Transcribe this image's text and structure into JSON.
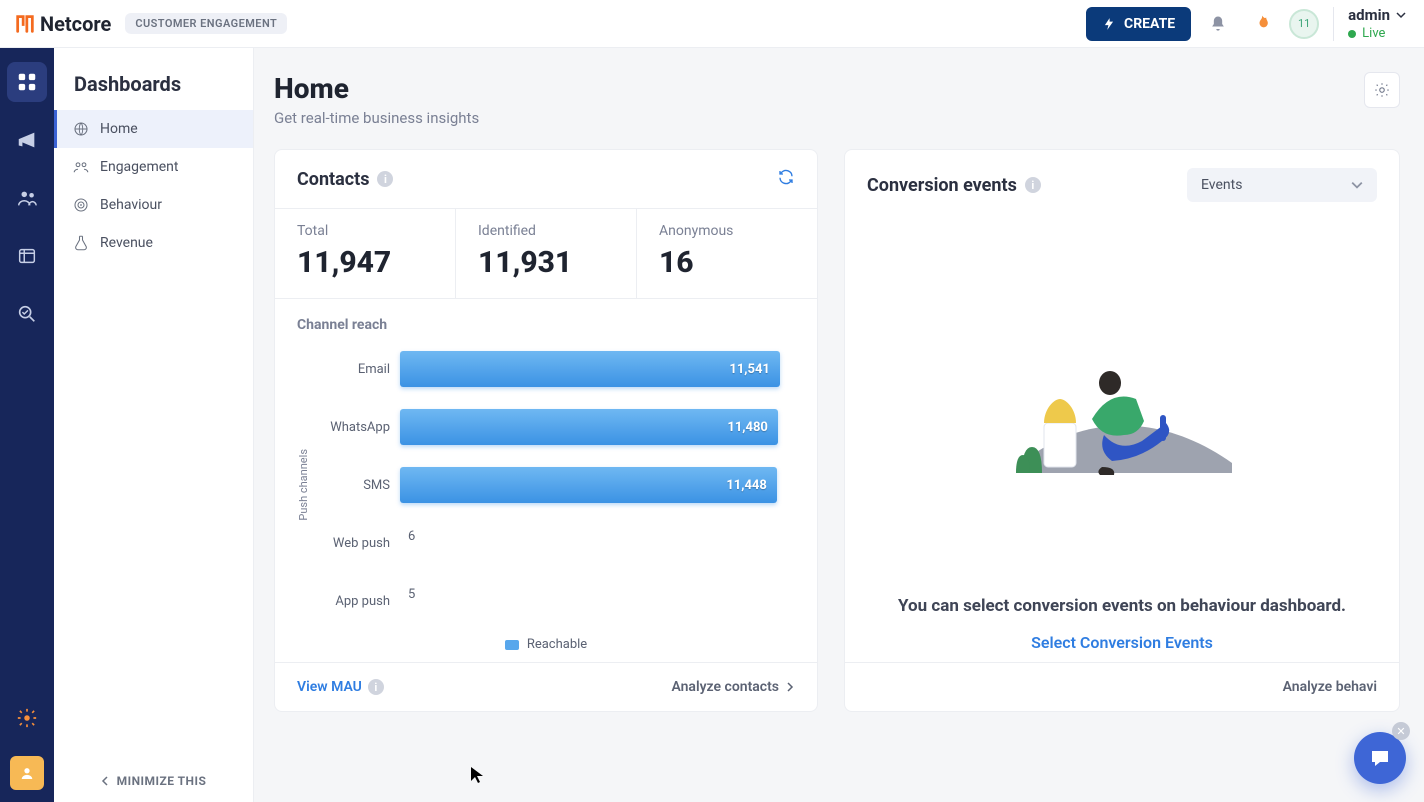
{
  "brand": {
    "name": "Netcore",
    "product_chip": "CUSTOMER ENGAGEMENT"
  },
  "topbar": {
    "create_label": "CREATE",
    "avatar_badge": "11",
    "user_name": "admin",
    "status_label": "Live"
  },
  "rail": {
    "items": [
      {
        "name": "dashboards",
        "active": true
      },
      {
        "name": "campaigns"
      },
      {
        "name": "audience"
      },
      {
        "name": "content"
      },
      {
        "name": "analytics"
      }
    ]
  },
  "sidebar": {
    "title": "Dashboards",
    "items": [
      {
        "label": "Home",
        "icon": "home",
        "active": true
      },
      {
        "label": "Engagement",
        "icon": "engagement"
      },
      {
        "label": "Behaviour",
        "icon": "behaviour"
      },
      {
        "label": "Revenue",
        "icon": "revenue"
      }
    ],
    "minimize_label": "MINIMIZE THIS"
  },
  "page": {
    "title": "Home",
    "subtitle": "Get real-time business insights"
  },
  "contacts_card": {
    "title": "Contacts",
    "stats": [
      {
        "label": "Total",
        "value": "11,947"
      },
      {
        "label": "Identified",
        "value": "11,931"
      },
      {
        "label": "Anonymous",
        "value": "16"
      }
    ],
    "channel_reach_title": "Channel reach",
    "view_mau_label": "View MAU",
    "analyze_label": "Analyze contacts"
  },
  "conversion_card": {
    "title": "Conversion events",
    "select_label": "Events",
    "empty_message": "You can select conversion events on behaviour dashboard.",
    "select_link": "Select Conversion Events",
    "analyze_label": "Analyze behavi"
  },
  "chart_data": {
    "type": "bar",
    "orientation": "horizontal",
    "title": "Channel reach",
    "ylabel": "Push channels",
    "xlabel": "",
    "xlim": [
      0,
      12000
    ],
    "categories": [
      "Email",
      "WhatsApp",
      "SMS",
      "Web push",
      "App push"
    ],
    "series": [
      {
        "name": "Reachable",
        "values": [
          11541,
          11480,
          11448,
          6,
          5
        ]
      }
    ],
    "legend": [
      "Reachable"
    ]
  }
}
